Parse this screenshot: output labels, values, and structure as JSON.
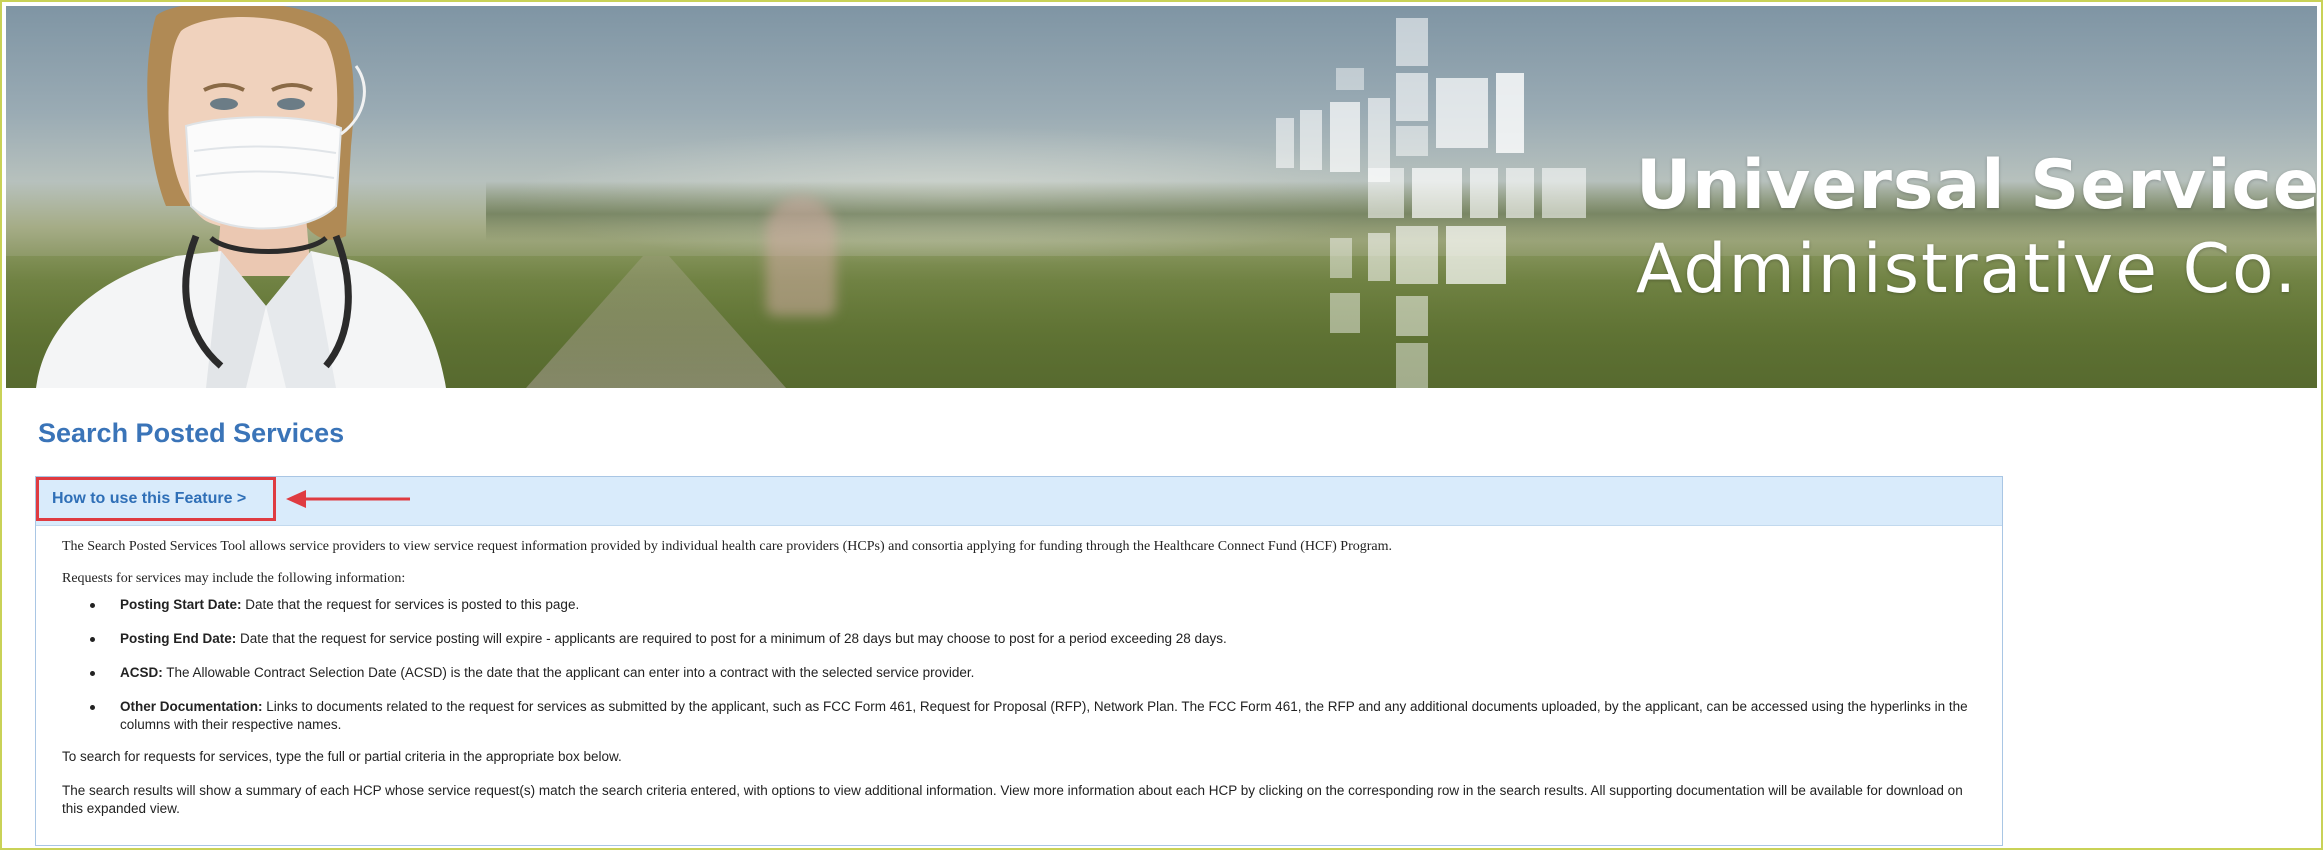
{
  "banner": {
    "brand_line1": "Universal Service",
    "brand_line2": "Administrative Co."
  },
  "page": {
    "title": "Search Posted Services"
  },
  "info_panel": {
    "toggle_label": "How to use this Feature >",
    "intro": "The Search Posted Services Tool allows service providers to view service request information provided by individual health care providers (HCPs) and consortia applying for funding through the Healthcare Connect Fund (HCF) Program.",
    "requests_intro": "Requests for services may include the following information:",
    "items": [
      {
        "term": "Posting Start Date:",
        "text": " Date that the request for services is posted to this page."
      },
      {
        "term": "Posting End Date:",
        "text": " Date that the request for service posting will expire - applicants are required to post for a minimum of 28 days but may choose to post for a period exceeding 28 days."
      },
      {
        "term": "ACSD:",
        "text": " The Allowable Contract Selection Date (ACSD) is the date that the applicant can enter into a contract with the selected service provider."
      },
      {
        "term": "Other Documentation:",
        "text": " Links to documents related to the request for services as submitted by the applicant, such as FCC Form 461, Request for Proposal (RFP), Network Plan. The FCC Form 461, the RFP and any additional documents uploaded, by the applicant, can be accessed using the hyperlinks in the columns with their respective names."
      }
    ],
    "search_hint": "To search for requests for services, type the full or partial criteria in the appropriate box below.",
    "results_note": "The search results will show a summary of each HCP whose service request(s) match the search criteria entered, with options to view additional information. View more information about each HCP by clicking on the corresponding row in the search results. All supporting documentation will be available for download on this expanded view."
  },
  "colors": {
    "title_blue": "#3a74b8",
    "panel_header_bg": "#d9ebfb",
    "highlight_red": "#df3b41",
    "frame_border": "#c9d257"
  }
}
